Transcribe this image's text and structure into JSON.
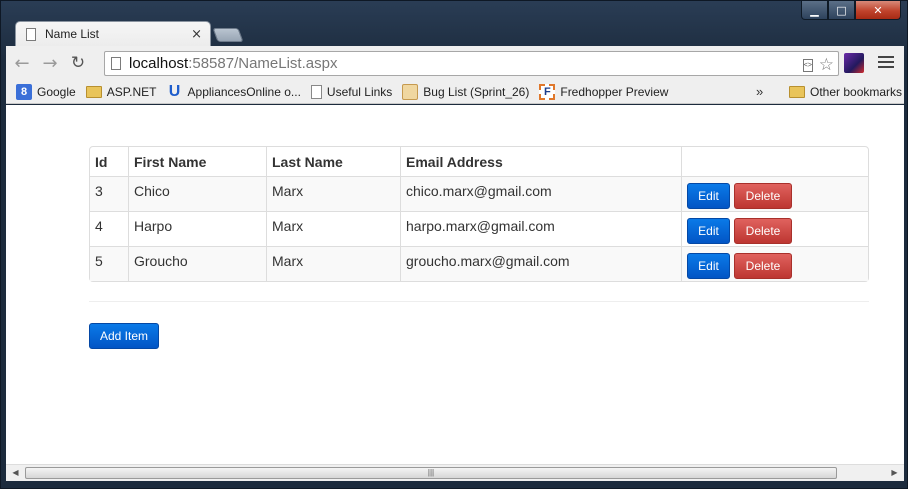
{
  "window": {
    "minimize_glyph": "▁",
    "maximize_glyph": "□",
    "close_glyph": "✕"
  },
  "tab": {
    "title": "Name List",
    "close_glyph": "×"
  },
  "toolbar": {
    "back_glyph": "←",
    "forward_glyph": "→",
    "reload_glyph": "↻",
    "star_glyph": "☆"
  },
  "address": {
    "host": "localhost",
    "rest": ":58587/NameList.aspx"
  },
  "bookmarks": {
    "items": [
      {
        "label": "Google",
        "icon": "google-icon"
      },
      {
        "label": "ASP.NET",
        "icon": "folder-icon"
      },
      {
        "label": "AppliancesOnline o...",
        "icon": "u-logo-icon"
      },
      {
        "label": "Useful Links",
        "icon": "page-icon"
      },
      {
        "label": "Bug List (Sprint_26)",
        "icon": "bug-icon"
      },
      {
        "label": "Fredhopper Preview",
        "icon": "f-logo-icon"
      }
    ],
    "overflow": "»",
    "other": "Other bookmarks"
  },
  "table": {
    "headers": [
      "Id",
      "First Name",
      "Last Name",
      "Email Address",
      ""
    ],
    "rows": [
      {
        "id": "3",
        "first": "Chico",
        "last": "Marx",
        "email": "chico.marx@gmail.com"
      },
      {
        "id": "4",
        "first": "Harpo",
        "last": "Marx",
        "email": "harpo.marx@gmail.com"
      },
      {
        "id": "5",
        "first": "Groucho",
        "last": "Marx",
        "email": "groucho.marx@gmail.com"
      }
    ],
    "edit_label": "Edit",
    "delete_label": "Delete"
  },
  "add_item_label": "Add Item",
  "scrollbar": {
    "left_arrow": "◀",
    "right_arrow": "▶",
    "grip": "|||"
  },
  "colors": {
    "primary": "#0a6fe0",
    "danger": "#d9534f"
  }
}
